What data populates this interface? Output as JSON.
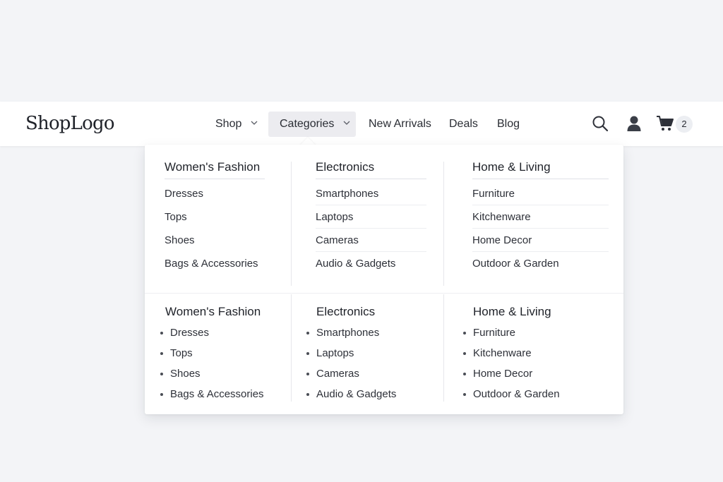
{
  "header": {
    "logo": "ShopLogo",
    "nav": {
      "shop": "Shop",
      "categories": "Categories",
      "new_arrivals": "New Arrivals",
      "deals": "Deals",
      "blog": "Blog"
    },
    "cart_count": "2",
    "icons": {
      "search": "search-icon",
      "account": "user-icon",
      "cart": "cart-icon"
    }
  },
  "menu": {
    "columns": [
      {
        "title": "Women's Fashion",
        "items": [
          "Dresses",
          "Tops",
          "Shoes",
          "Bags & Accessories"
        ]
      },
      {
        "title": "Electronics",
        "items": [
          "Smartphones",
          "Laptops",
          "Cameras",
          "Audio & Gadgets"
        ]
      },
      {
        "title": "Home & Living",
        "items": [
          "Furniture",
          "Kitchenware",
          "Home Decor",
          "Outdoor & Garden"
        ]
      }
    ],
    "columns_list": [
      {
        "title": "Women's Fashion",
        "items": [
          "Dresses",
          "Tops",
          "Shoes",
          "Bags & Accessories"
        ]
      },
      {
        "title": "Electronics",
        "items": [
          "Smartphones",
          "Laptops",
          "Cameras",
          "Audio & Gadgets"
        ]
      },
      {
        "title": "Home & Living",
        "items": [
          "Furniture",
          "Kitchenware",
          "Home Decor",
          "Outdoor & Garden"
        ]
      }
    ]
  },
  "colors": {
    "page_bg": "#f3f4f7",
    "surface": "#ffffff",
    "active_nav_bg": "#ececf0",
    "text": "#23262d"
  }
}
